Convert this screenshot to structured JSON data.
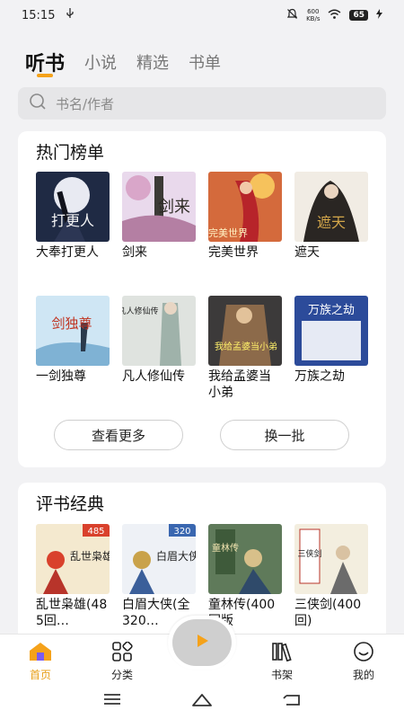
{
  "status_bar": {
    "time": "15:15",
    "usb_icon": "usb-icon",
    "net_speed_value": "600",
    "net_speed_unit": "KB/s",
    "battery": "65"
  },
  "tabs": [
    {
      "label": "听书",
      "active": true
    },
    {
      "label": "小说",
      "active": false
    },
    {
      "label": "精选",
      "active": false
    },
    {
      "label": "书单",
      "active": false
    }
  ],
  "search": {
    "placeholder": "书名/作者"
  },
  "hot_list": {
    "title": "热门榜单",
    "books": [
      {
        "title": "大奉打更人",
        "cover_text": "打更人"
      },
      {
        "title": "剑来",
        "cover_text": "剑来"
      },
      {
        "title": "完美世界",
        "cover_text": "完美世界"
      },
      {
        "title": "遮天",
        "cover_text": "遮天"
      },
      {
        "title": "一剑独尊",
        "cover_text": "剑独尊"
      },
      {
        "title": "凡人修仙传",
        "cover_text": "凡人修仙传"
      },
      {
        "title": "我给孟婆当小弟",
        "cover_text": "我给孟婆当小弟"
      },
      {
        "title": "万族之劫",
        "cover_text": "万族之劫"
      }
    ],
    "more_label": "查看更多",
    "refresh_label": "换一批"
  },
  "classic": {
    "title": "评书经典",
    "books": [
      {
        "title": "乱世枭雄(485回…",
        "cover_text": "乱世枭雄",
        "badge": "485"
      },
      {
        "title": "白眉大侠(全320…",
        "cover_text": "白眉大侠",
        "badge": "320"
      },
      {
        "title": "童林传(400回版",
        "cover_text": "童林传",
        "badge": ""
      },
      {
        "title": "三侠剑(400回)",
        "cover_text": "三侠剑",
        "badge": ""
      }
    ]
  },
  "bottom_nav": [
    {
      "label": "首页",
      "icon": "home-icon",
      "active": true
    },
    {
      "label": "分类",
      "icon": "category-icon",
      "active": false
    },
    {
      "label": "书架",
      "icon": "bookshelf-icon",
      "active": false
    },
    {
      "label": "我的",
      "icon": "profile-icon",
      "active": false
    }
  ],
  "colors": {
    "accent": "#f5a21a",
    "background": "#f2f2f4",
    "card": "#ffffff"
  }
}
